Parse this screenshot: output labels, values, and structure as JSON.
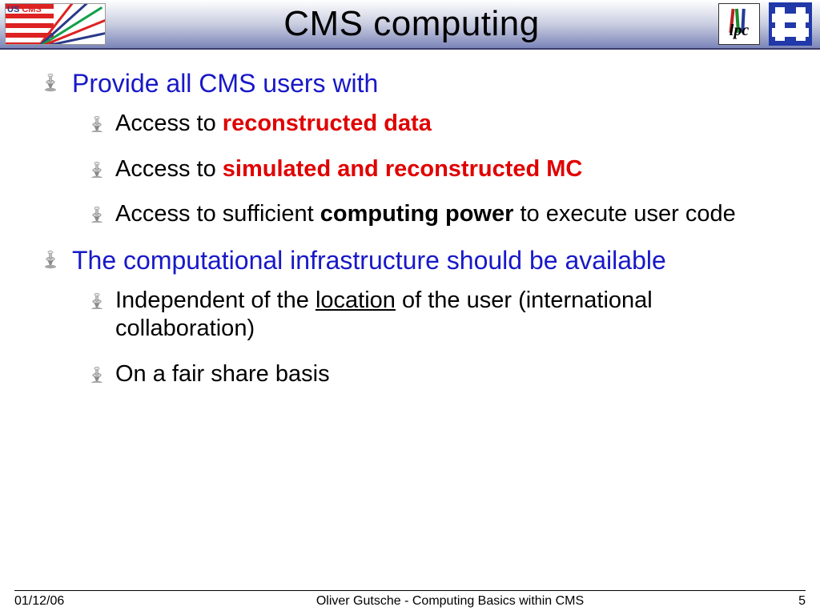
{
  "header": {
    "title": "CMS computing",
    "logo_left_label_a": "US",
    "logo_left_label_b": "CMS",
    "lpc_text": "lpc"
  },
  "bullets": {
    "b1": "Provide all CMS users with",
    "b1a_pre": "Access to ",
    "b1a_hl": "reconstructed data",
    "b1b_pre": "Access to ",
    "b1b_hl": "simulated and reconstructed MC",
    "b1c_pre": "Access to sufficient ",
    "b1c_bold": "computing power",
    "b1c_post": " to execute user code",
    "b2": "The computational infrastructure should be available",
    "b2a_pre": "Independent of the ",
    "b2a_ul": "location",
    "b2a_post": " of the user (international collaboration)",
    "b2b": "On a fair share basis"
  },
  "footer": {
    "date": "01/12/06",
    "center": "Oliver Gutsche - Computing Basics within CMS",
    "page": "5"
  }
}
